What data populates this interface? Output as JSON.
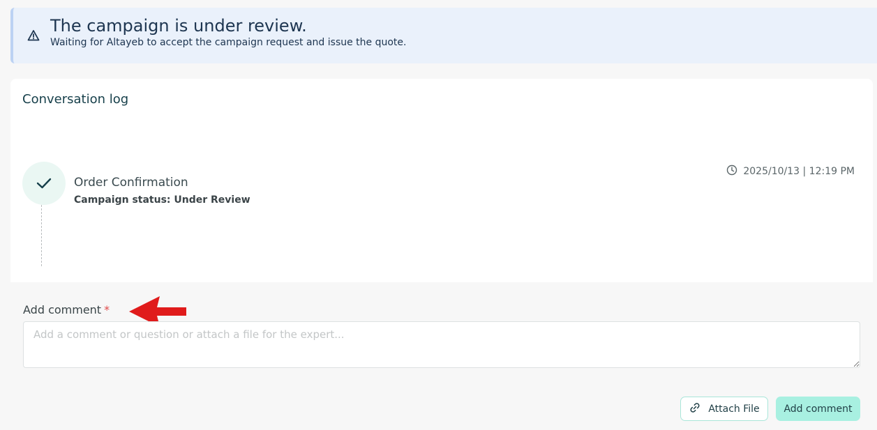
{
  "alert": {
    "icon": "warning-icon",
    "title": "The campaign is under review.",
    "description": "Waiting for Altayeb to accept the campaign request and issue the quote."
  },
  "conversation": {
    "title": "Conversation log",
    "events": [
      {
        "icon": "check-icon",
        "title": "Order Confirmation",
        "status": "Campaign status: Under Review",
        "timestamp": "2025/10/13 | 12:19 PM"
      }
    ]
  },
  "comment": {
    "label": "Add comment",
    "required_mark": "*",
    "placeholder": "Add a comment or question or attach a file for the expert...",
    "value": "",
    "attach_label": "Attach File",
    "submit_label": "Add comment"
  },
  "colors": {
    "alert_bg": "#eaf1fb",
    "accent": "#a8f0e1",
    "required": "#e04a4a",
    "annotation_arrow": "#e01b1b"
  }
}
